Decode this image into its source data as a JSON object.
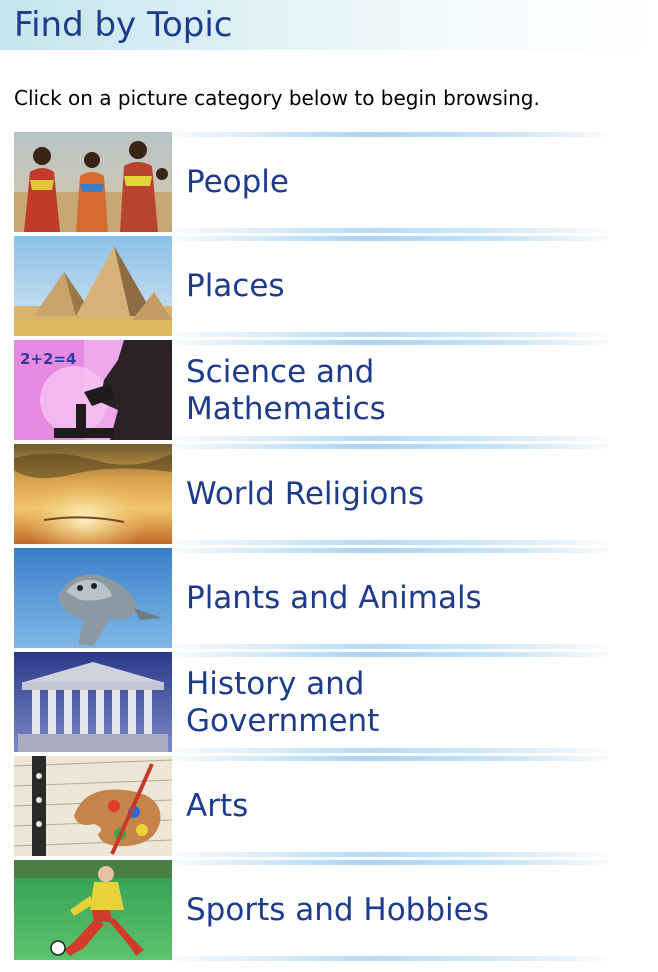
{
  "header": {
    "title": "Find by Topic"
  },
  "intro": {
    "text": "Click on a picture category below to begin browsing."
  },
  "topics": [
    {
      "line1": "People",
      "line2": "",
      "thumb": "people-photo"
    },
    {
      "line1": "Places",
      "line2": "",
      "thumb": "pyramids-photo"
    },
    {
      "line1": "Science and",
      "line2": "Mathematics",
      "thumb": "microscope-photo",
      "thumb_text": "2+2=4"
    },
    {
      "line1": "World Religions",
      "line2": "",
      "thumb": "sunset-photo"
    },
    {
      "line1": "Plants and Animals",
      "line2": "",
      "thumb": "seal-photo"
    },
    {
      "line1": "History and",
      "line2": "Government",
      "thumb": "parthenon-photo"
    },
    {
      "line1": "Arts",
      "line2": "",
      "thumb": "palette-photo"
    },
    {
      "line1": "Sports and Hobbies",
      "line2": "",
      "thumb": "soccer-photo"
    }
  ],
  "colors": {
    "link": "#1e3b8c",
    "divider": "#a9d3f3",
    "header_bg": "#c5e4ed"
  }
}
